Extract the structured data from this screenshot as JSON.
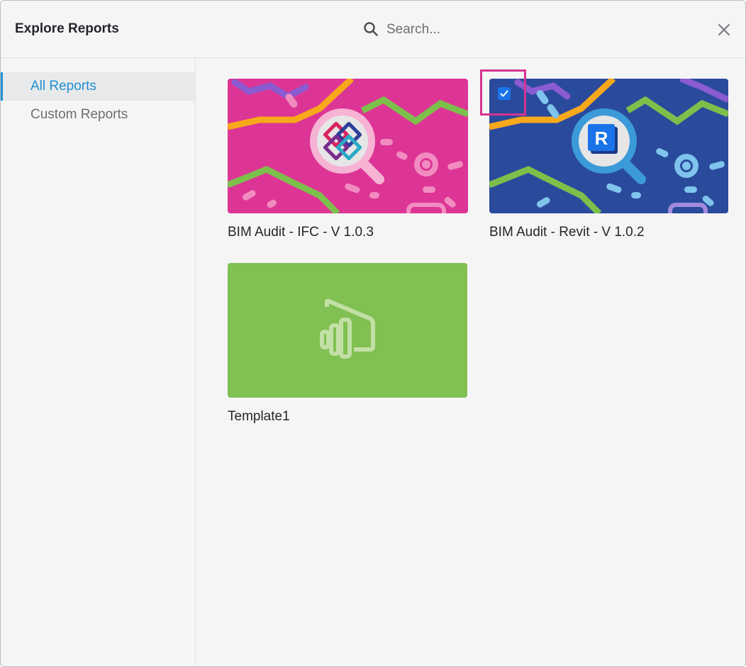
{
  "header": {
    "title": "Explore Reports",
    "search_placeholder": "Search...",
    "search_value": ""
  },
  "sidebar": {
    "items": [
      {
        "label": "All Reports",
        "active": true
      },
      {
        "label": "Custom Reports",
        "active": false
      }
    ]
  },
  "reports": [
    {
      "label": "BIM Audit - IFC - V 1.0.3",
      "thumbnail": "ifc-logo-magnifier",
      "background": "#dc3595",
      "selected": false
    },
    {
      "label": "BIM Audit - Revit - V 1.0.2",
      "thumbnail": "revit-logo-magnifier",
      "background": "#2a4a9c",
      "selected": true
    },
    {
      "label": "Template1",
      "thumbnail": "powerbi-icon",
      "background": "#81c052",
      "selected": false
    }
  ],
  "colors": {
    "accent": "#1f8fd1",
    "checkbox": "#1a73e8",
    "highlight": "#d6338f"
  }
}
